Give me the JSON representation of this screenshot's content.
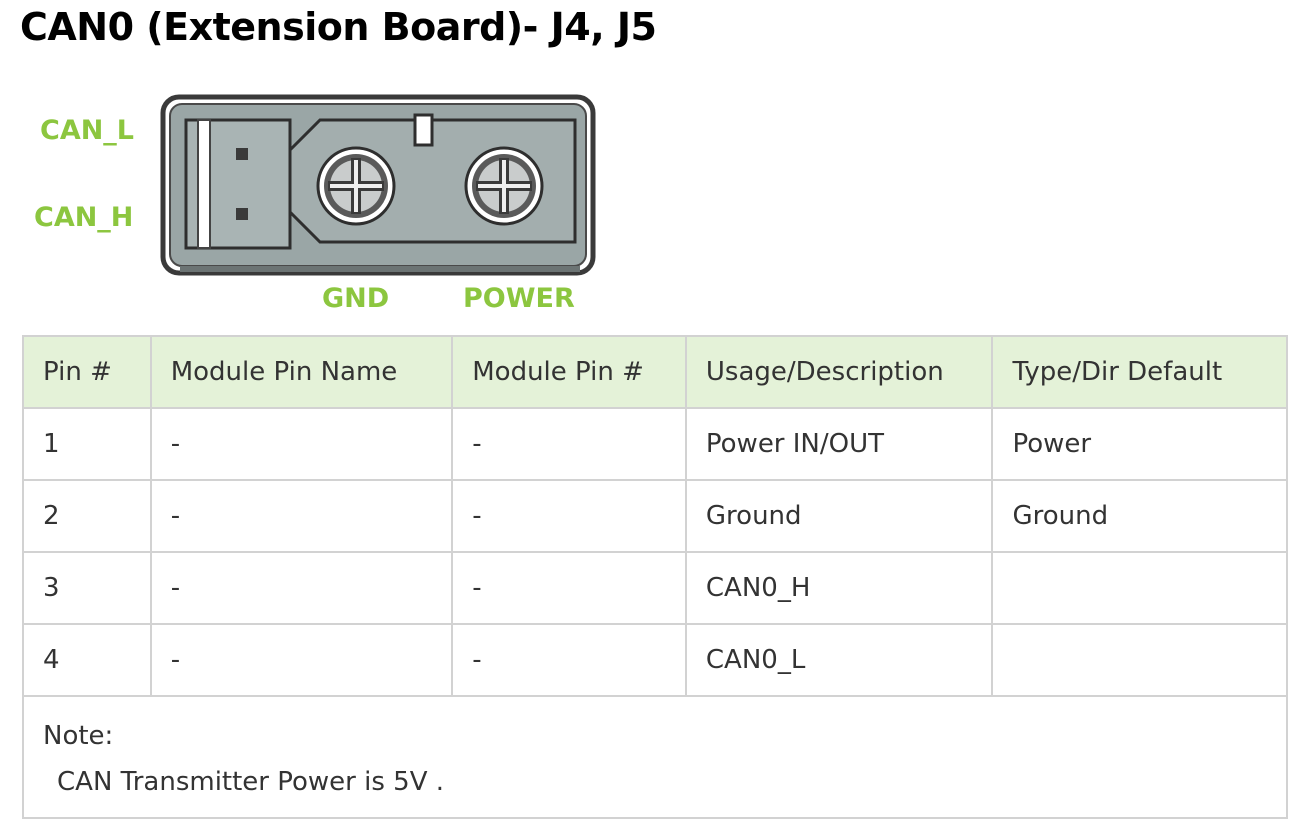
{
  "page": {
    "title": "CAN0 (Extension Board)- J4, J5"
  },
  "figure": {
    "labels": {
      "can_l": "CAN_L",
      "can_h": "CAN_H",
      "gnd": "GND",
      "power": "POWER"
    },
    "label_color": "#8cc63f",
    "housing_color": "#9aa6a6"
  },
  "table": {
    "header_color": "#e4f2d8",
    "columns": [
      "Pin #",
      "Module Pin Name",
      "Module Pin #",
      "Usage/Description",
      "Type/Dir Default"
    ],
    "rows": [
      [
        "1",
        "-",
        "-",
        "Power IN/OUT",
        "Power"
      ],
      [
        "2",
        "-",
        "-",
        "Ground",
        "Ground"
      ],
      [
        "3",
        "-",
        "-",
        "CAN0_H",
        ""
      ],
      [
        "4",
        "-",
        "-",
        "CAN0_L",
        ""
      ]
    ],
    "note_label": "Note:",
    "note_text": "CAN Transmitter Power is 5V ."
  }
}
